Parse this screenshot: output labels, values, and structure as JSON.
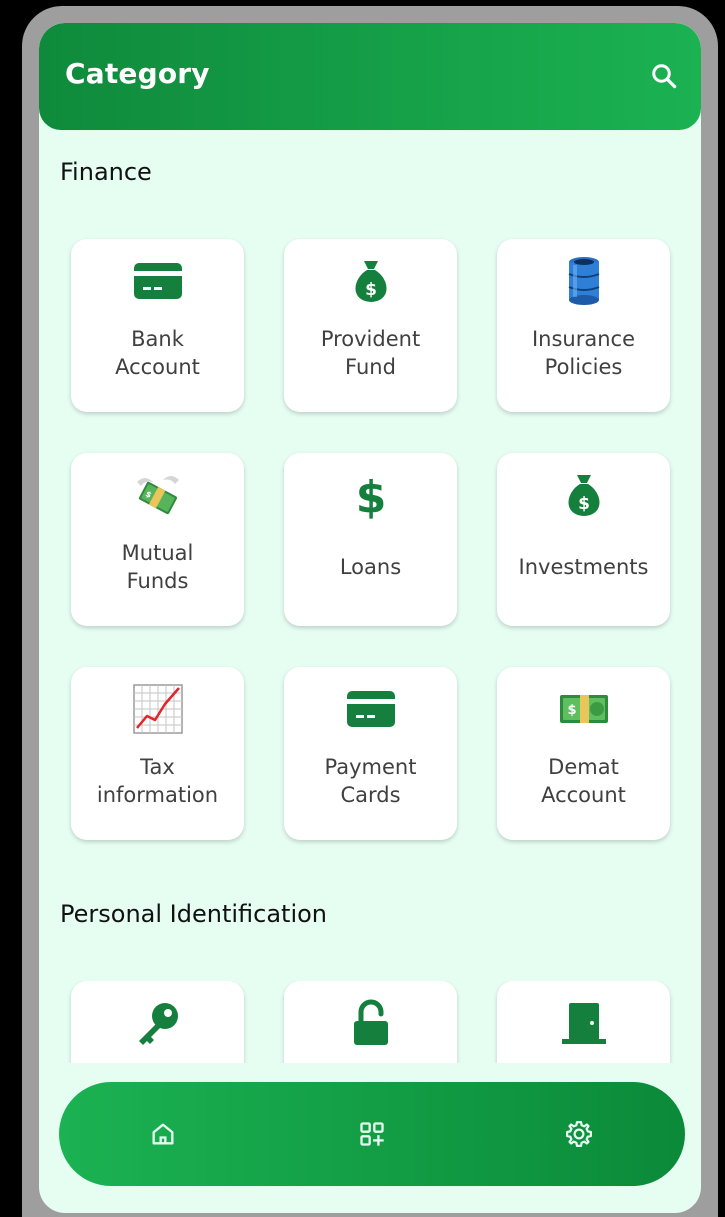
{
  "header": {
    "title": "Category",
    "search_icon": "search-icon"
  },
  "sections": [
    {
      "title": "Finance",
      "items": [
        {
          "label": "Bank\nAccount",
          "icon": "credit-card-icon"
        },
        {
          "label": "Provident\nFund",
          "icon": "money-bag-icon"
        },
        {
          "label": "Insurance\nPolicies",
          "icon": "oil-drum-icon"
        },
        {
          "label": "Mutual\nFunds",
          "icon": "money-with-wings-icon"
        },
        {
          "label": "Loans",
          "icon": "dollar-sign-icon"
        },
        {
          "label": "Investments",
          "icon": "money-bag-icon"
        },
        {
          "label": "Tax\ninformation",
          "icon": "chart-increasing-icon"
        },
        {
          "label": "Payment\nCards",
          "icon": "credit-card-icon"
        },
        {
          "label": "Demat\nAccount",
          "icon": "banknote-icon"
        }
      ]
    },
    {
      "title": "Personal Identification",
      "items": [
        {
          "icon": "key-icon"
        },
        {
          "icon": "lock-open-icon"
        },
        {
          "icon": "door-icon"
        }
      ]
    }
  ],
  "bottom_nav": [
    {
      "icon": "home-icon",
      "label": "Home"
    },
    {
      "icon": "grid-add-icon",
      "label": "Categories"
    },
    {
      "icon": "settings-gear-icon",
      "label": "Settings"
    }
  ],
  "colors": {
    "brand": "#16a34a",
    "background": "#e6fdf2",
    "tile": "#ffffff",
    "icon": "#15803d"
  }
}
